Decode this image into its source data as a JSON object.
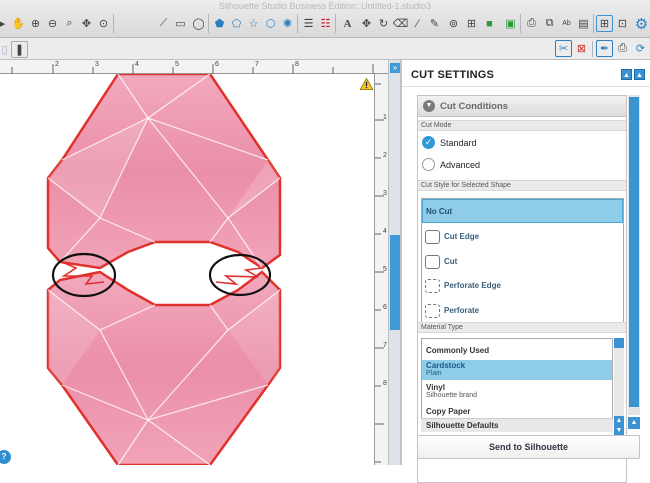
{
  "window": {
    "title": "Silhouette Studio Business Edition: Untitled-1.studio3"
  },
  "toolbar": {
    "icons": [
      "select-icon",
      "pan-icon",
      "zoom-in-icon",
      "zoom-out-icon",
      "zoom-drag-icon",
      "zoom-fit-icon",
      "zoom-page-icon"
    ]
  },
  "ruler": {
    "top_labels": [
      "2",
      "3",
      "4",
      "5",
      "6",
      "7",
      "8"
    ],
    "side_labels": [
      "1",
      "2",
      "3",
      "4",
      "5",
      "6",
      "7",
      "8"
    ]
  },
  "panel": {
    "title": "CUT SETTINGS",
    "cut_conditions_label": "Cut Conditions",
    "cut_mode_label": "Cut Mode",
    "mode_standard": "Standard",
    "mode_advanced": "Advanced",
    "cut_style_label": "Cut Style for Selected Shape",
    "styles": [
      {
        "label": "No Cut",
        "selected": true
      },
      {
        "label": "Cut Edge",
        "selected": false
      },
      {
        "label": "Cut",
        "selected": false
      },
      {
        "label": "Perforate Edge",
        "selected": false
      },
      {
        "label": "Perforate",
        "selected": false
      }
    ],
    "material_type_label": "Material Type",
    "materials": [
      {
        "name": "Commonly Used",
        "sub": ""
      },
      {
        "name": "Cardstock",
        "sub": "Plain",
        "selected": true
      },
      {
        "name": "Vinyl",
        "sub": "Silhouette brand"
      },
      {
        "name": "Copy Paper",
        "sub": ""
      }
    ],
    "defaults_label": "Silhouette Defaults",
    "send_button": "Send to Silhouette"
  },
  "colors": {
    "accent": "#3a93d3",
    "selection": "#8fcce8",
    "gem_outline": "#e53935",
    "gem_fill": "#ee8ea8"
  }
}
